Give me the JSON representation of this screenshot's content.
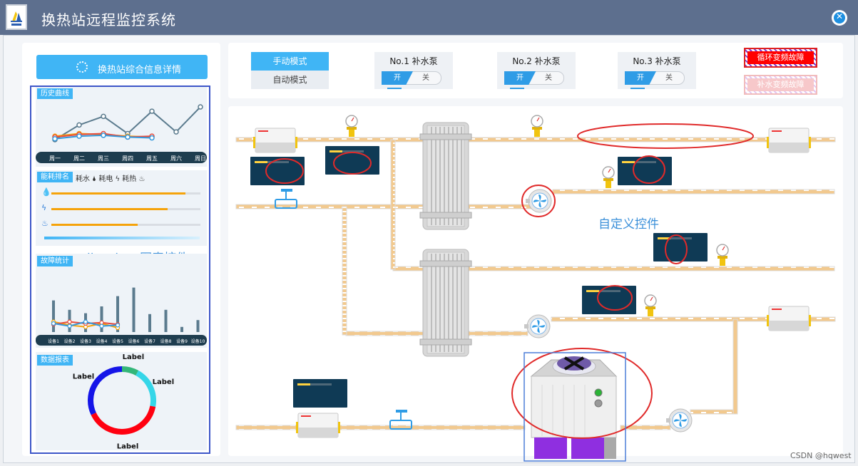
{
  "window": {
    "title": "换热站远程监控系统"
  },
  "left": {
    "overview_button": "换热站综合信息详情",
    "history": {
      "title": "历史曲线",
      "days": [
        "周一",
        "周二",
        "周三",
        "周四",
        "周五",
        "周六",
        "周日"
      ],
      "series": [
        {
          "color": "#5b7b8e",
          "values": [
            5,
            22,
            32,
            12,
            38,
            14,
            43
          ]
        },
        {
          "color": "#f5a30b",
          "values": [
            9,
            12,
            11,
            9,
            8,
            null,
            null
          ]
        },
        {
          "color": "#e74c3c",
          "values": [
            8,
            11,
            12,
            8,
            9,
            null,
            null
          ]
        },
        {
          "color": "#3498db",
          "values": [
            6,
            9,
            10,
            8,
            7,
            null,
            null
          ]
        }
      ],
      "ymax": 48
    },
    "energy": {
      "title": "能耗排名",
      "legend": "耗水 🌢 耗电 ϟ 耗热 ♨",
      "rows": [
        {
          "icon": "💧",
          "value": 0.9
        },
        {
          "icon": "ϟ",
          "value": 0.78
        },
        {
          "icon": "♨",
          "value": 0.58
        }
      ]
    },
    "fault": {
      "title": "故障统计",
      "devices": [
        "设备1",
        "设备2",
        "设备3",
        "设备4",
        "设备5",
        "设备6",
        "设备7",
        "设备8",
        "设备9",
        "设备10"
      ],
      "bars": [
        37,
        26,
        22,
        30,
        42,
        52,
        21,
        26,
        6,
        14
      ],
      "series": [
        {
          "color": "#f5a30b",
          "values": [
            12,
            8,
            6,
            10,
            5,
            null,
            null,
            null,
            null,
            null
          ]
        },
        {
          "color": "#e74c3c",
          "values": [
            9,
            12,
            10,
            11,
            9,
            null,
            null,
            null,
            null,
            null
          ]
        },
        {
          "color": "#3498db",
          "values": [
            10,
            7,
            12,
            7,
            8,
            null,
            null,
            null,
            null,
            null
          ]
        }
      ],
      "ymax": 60
    },
    "report": {
      "title": "数据报表",
      "slices": [
        {
          "label": "Label",
          "value": 8,
          "color": "#33b679"
        },
        {
          "label": "Label",
          "value": 20,
          "color": "#35d6e8"
        },
        {
          "label": "Label",
          "value": 40,
          "color": "#ff0010"
        },
        {
          "label": "Label",
          "value": 32,
          "color": "#1515e8"
        }
      ]
    }
  },
  "annotations": {
    "livechart": "livechart图表控件",
    "custom": "自定义控件"
  },
  "controls": {
    "mode_manual": "手动模式",
    "mode_auto": "自动模式",
    "pumps": [
      {
        "name": "No.1 补水泵",
        "on": "开",
        "off": "关"
      },
      {
        "name": "No.2 补水泵",
        "on": "开",
        "off": "关"
      },
      {
        "name": "No.3 补水泵",
        "on": "开",
        "off": "关"
      }
    ],
    "fault_circ": "循环变频故障",
    "fault_makeup": "补水变频故障"
  },
  "watermark": "CSDN @hqwest"
}
